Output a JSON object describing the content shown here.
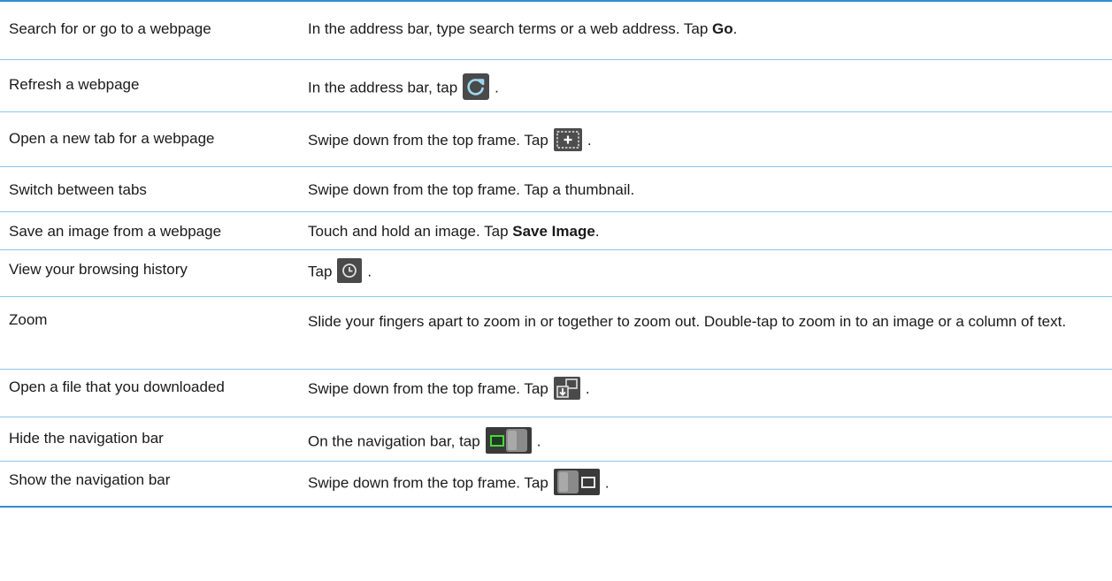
{
  "rows": [
    {
      "task": "Search for or go to a webpage",
      "desc_pre": "In the address bar, type search terms or a web address. Tap ",
      "desc_bold": "Go",
      "desc_post": "."
    },
    {
      "task": "Refresh a webpage",
      "desc_pre": "In the address bar, tap",
      "icon": "refresh-icon",
      "desc_post": "."
    },
    {
      "task": "Open a new tab for a webpage",
      "desc_pre": "Swipe down from the top frame. Tap",
      "icon": "new-tab-icon",
      "desc_post": "."
    },
    {
      "task": "Switch between tabs",
      "desc_pre": "Swipe down from the top frame. Tap a thumbnail."
    },
    {
      "task": "Save an image from a webpage",
      "desc_pre": "Touch and hold an image. Tap ",
      "desc_bold": "Save Image",
      "desc_post": "."
    },
    {
      "task": "View your browsing history",
      "desc_pre": "Tap",
      "icon": "history-clock-icon",
      "desc_post": "."
    },
    {
      "task": "Zoom",
      "desc_pre": "Slide your fingers apart to zoom in or together to zoom out. Double-tap to zoom in to an image or a column of text."
    },
    {
      "task": "Open a file that you downloaded",
      "desc_pre": "Swipe down from the top frame. Tap",
      "icon": "downloads-icon",
      "desc_post": "."
    },
    {
      "task": "Hide the navigation bar",
      "desc_pre": "On the navigation bar, tap",
      "icon": "hide-nav-bar-icon",
      "desc_post": "."
    },
    {
      "task": "Show the navigation bar",
      "desc_pre": "Swipe down from the top frame. Tap",
      "icon": "show-nav-bar-icon",
      "desc_post": "."
    }
  ],
  "colors": {
    "rule_dark": "#2e8fd0",
    "rule_light": "#8cc4e8",
    "icon_bg": "#4a4a4a"
  }
}
